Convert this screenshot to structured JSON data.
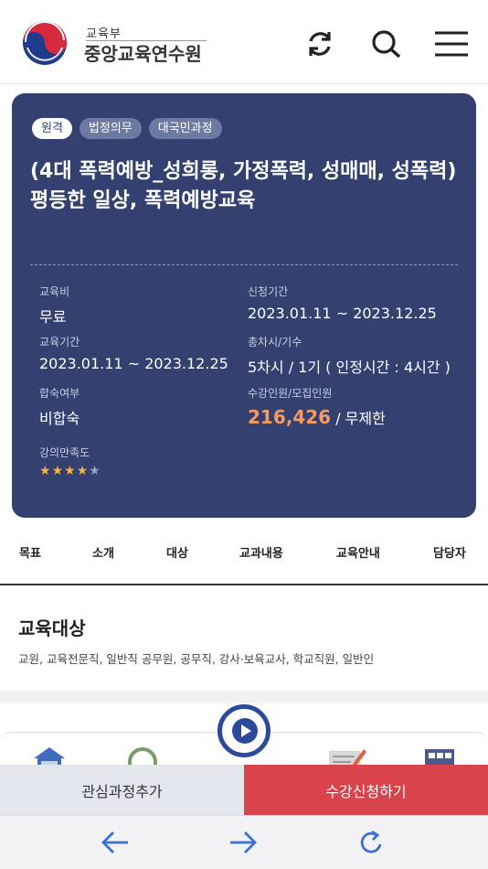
{
  "header": {
    "logo_top": "교육부",
    "logo_main": "중앙교육연수원",
    "icons": [
      "refresh-icon",
      "search-icon",
      "menu-icon"
    ]
  },
  "course": {
    "tags": [
      "원격",
      "법정의무",
      "대국민과정"
    ],
    "title": "(4대 폭력예방_성희롱, 가정폭력, 성매매, 성폭력)평등한 일상, 폭력예방교육",
    "fields": {
      "fee_label": "교육비",
      "fee_value": "무료",
      "apply_period_label": "신청기간",
      "apply_period_value": "2023.01.11 ~ 2023.12.25",
      "edu_period_label": "교육기간",
      "edu_period_value": "2023.01.11 ~ 2023.12.25",
      "sessions_label": "총차시/기수",
      "sessions_value": "5차시 / 1기 ( 인정시간 : 4시간 )",
      "lodging_label": "합숙여부",
      "lodging_value": "비합숙",
      "enroll_label": "수강인원/모집인원",
      "enroll_count": "216,426",
      "enroll_limit": "/ 무제한",
      "rating_label": "강의만족도"
    },
    "rating": {
      "filled": 4,
      "total": 5,
      "star_color": "#f5b535"
    }
  },
  "tabs": [
    "목표",
    "소개",
    "대상",
    "교과내용",
    "교육안내",
    "담당자"
  ],
  "section": {
    "title": "교육대상",
    "body": "교원, 교육전문직, 일반직 공무원, 공무직, 강사·보육교사, 학교직원, 일반인"
  },
  "actions": {
    "favorite": "관심과정추가",
    "apply": "수강신청하기"
  },
  "colors": {
    "card_bg": "#334070",
    "apply_btn": "#d9434b",
    "highlight": "#f49a63"
  }
}
